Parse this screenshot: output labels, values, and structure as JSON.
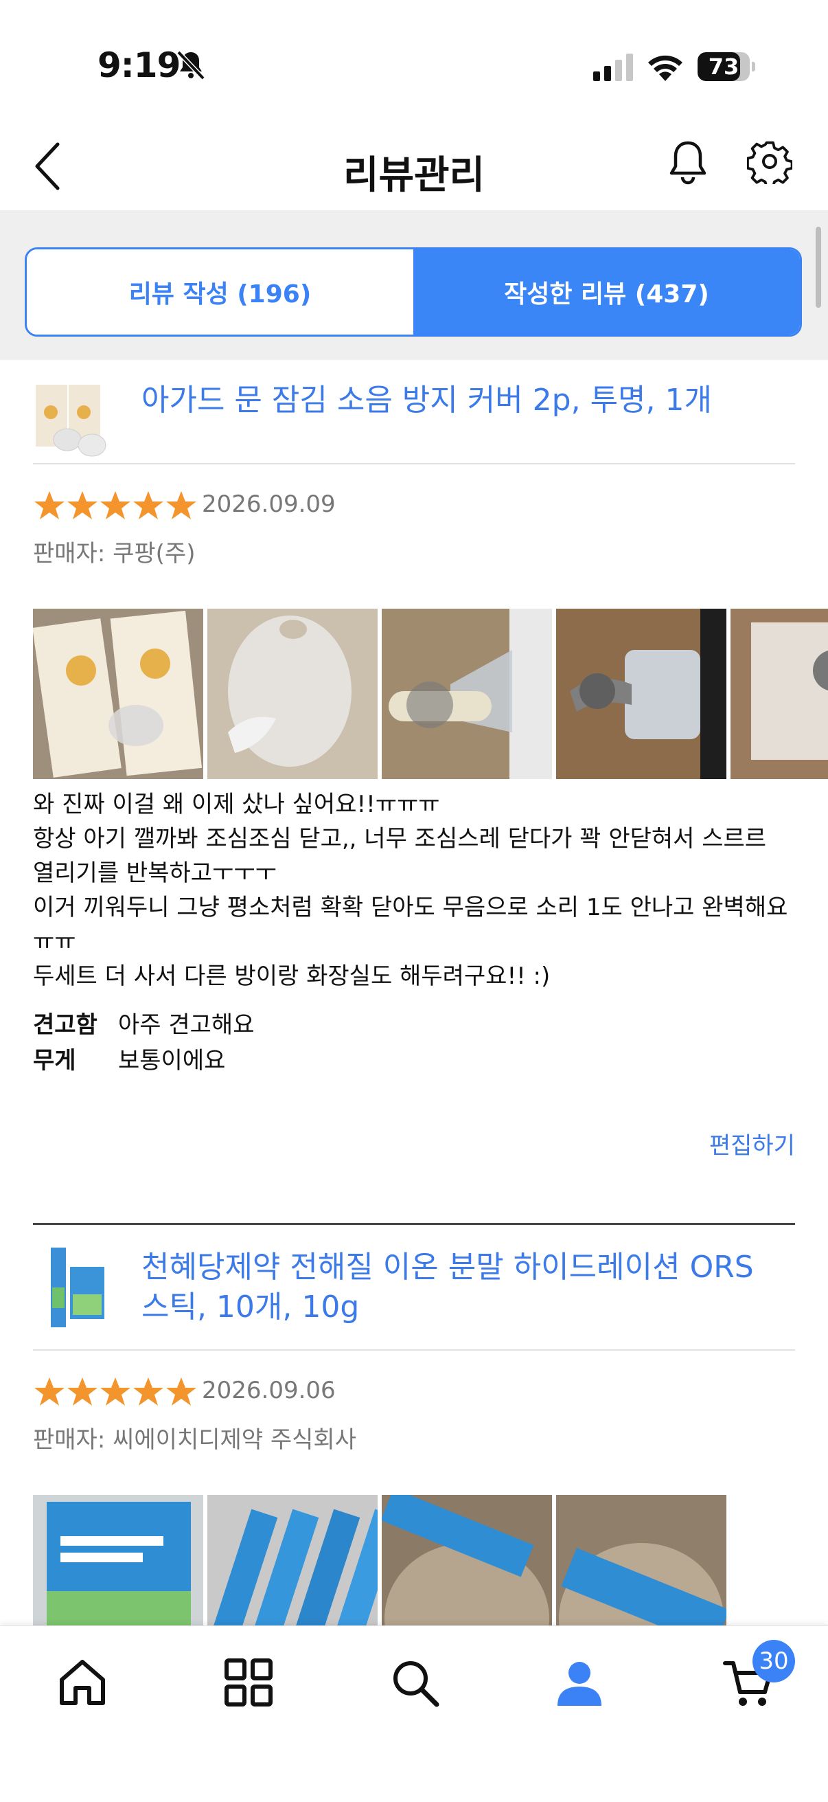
{
  "status_bar": {
    "time": "9:19",
    "battery": "73"
  },
  "header": {
    "title": "리뷰관리"
  },
  "tabs": [
    {
      "label": "리뷰 작성 (196)"
    },
    {
      "label": "작성한 리뷰 (437)"
    }
  ],
  "reviews": [
    {
      "product_name": "아가드 문 잠김 소음 방지 커버 2p, 투명, 1개",
      "rating": 5,
      "date": "2026.09.09",
      "seller": "판매자: 쿠팡(주)",
      "text": "와 진짜 이걸 왜 이제 샀나 싶어요!!ㅠㅠㅠ\n항상 아기 깰까봐 조심조심 닫고,, 너무 조심스레 닫다가 꽉 안닫혀서 스르르 열리기를 반복하고ㅜㅜㅜ\n이거 끼워두니 그냥 평소처럼 확확 닫아도 무음으로 소리 1도 안나고 완벽해요ㅠㅠ\n두세트 더 사서 다른 방이랑 화장실도 해두려구요!! :)",
      "attributes": [
        {
          "key": "견고함",
          "value": "아주 견고해요"
        },
        {
          "key": "무게",
          "value": "보통이에요"
        }
      ],
      "edit_label": "편집하기"
    },
    {
      "product_name": "천혜당제약 전해질 이온 분말 하이드레이션 ORS 스틱, 10개, 10g",
      "rating": 5,
      "date": "2026.09.06",
      "seller": "판매자: 씨에이치디제약 주식회사"
    }
  ],
  "bottom_nav": {
    "items": [
      "home-icon",
      "categories-icon",
      "search-icon",
      "my-page-icon",
      "cart-icon"
    ],
    "cart_count": "30"
  },
  "colors": {
    "accent": "#3b82f6",
    "star": "#f4942c"
  }
}
